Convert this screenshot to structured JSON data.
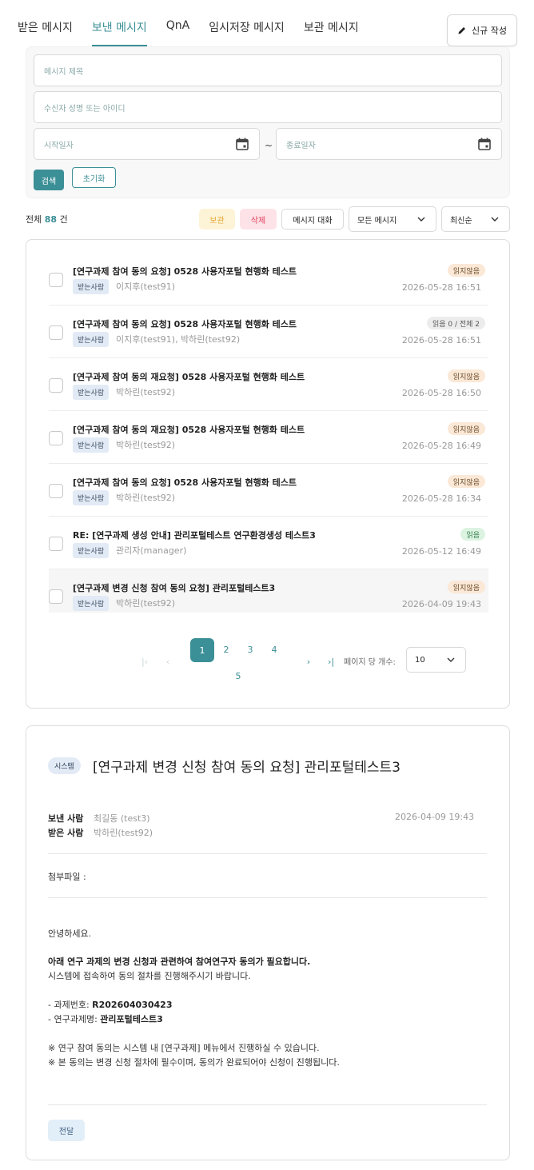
{
  "tabs": [
    {
      "label": "받은 메시지"
    },
    {
      "label": "보낸 메시지"
    },
    {
      "label": "QnA"
    },
    {
      "label": "임시저장 메시지"
    },
    {
      "label": "보관 메시지"
    }
  ],
  "active_tab": "보낸 메시지",
  "new_button": {
    "label": "신규 작성",
    "icon": "pencil-icon"
  },
  "search": {
    "title_placeholder": "메시지 제목",
    "recipient_placeholder": "수신자 성명 또는 아이디",
    "start_placeholder": "시작일자",
    "end_placeholder": "종료일자",
    "range_separator": "~",
    "search_label": "검색",
    "reset_label": "초기화"
  },
  "toolbar": {
    "total_prefix": "전체",
    "total_count": "88",
    "total_suffix": "건",
    "keep_label": "보관",
    "delete_label": "삭제",
    "conversation_label": "메시지 대화",
    "filter_value": "모든 메시지",
    "sort_value": "최신순"
  },
  "messages": [
    {
      "title": "[연구과제 참여 동의 요청] 0528 사용자포털 현행화 테스트",
      "recipient_tag": "받는사람",
      "recipients": "이지후(test91)",
      "status": "읽지않음",
      "status_type": "unread",
      "date": "2026-05-28 16:51"
    },
    {
      "title": "[연구과제 참여 동의 요청] 0528 사용자포털 현행화 테스트",
      "recipient_tag": "받는사람",
      "recipients": "이지후(test91), 박하린(test92)",
      "status": "읽음 0 / 전체 2",
      "status_type": "count",
      "date": "2026-05-28 16:51"
    },
    {
      "title": "[연구과제 참여 동의 재요청] 0528 사용자포털 현행화 테스트",
      "recipient_tag": "받는사람",
      "recipients": "박하린(test92)",
      "status": "읽지않음",
      "status_type": "unread",
      "date": "2026-05-28 16:50"
    },
    {
      "title": "[연구과제 참여 동의 재요청] 0528 사용자포털 현행화 테스트",
      "recipient_tag": "받는사람",
      "recipients": "박하린(test92)",
      "status": "읽지않음",
      "status_type": "unread",
      "date": "2026-05-28 16:49"
    },
    {
      "title": "[연구과제 참여 동의 요청] 0528 사용자포털 현행화 테스트",
      "recipient_tag": "받는사람",
      "recipients": "박하린(test92)",
      "status": "읽지않음",
      "status_type": "unread",
      "date": "2026-05-28 16:34"
    },
    {
      "title": "RE: [연구과제 생성 안내] 관리포털테스트 연구환경생성 테스트3",
      "recipient_tag": "받는사람",
      "recipients": "관리자(manager)",
      "status": "읽음",
      "status_type": "read",
      "date": "2026-05-12 16:49"
    },
    {
      "title": "[연구과제 변경 신청 참여 동의 요청] 관리포털테스트3",
      "recipient_tag": "받는사람",
      "recipients": "박하린(test92)",
      "status": "읽지않음",
      "status_type": "unread",
      "date": "2026-04-09 19:43"
    }
  ],
  "pagination": {
    "first": "|‹",
    "prev": "‹",
    "pages": [
      "1",
      "2",
      "3",
      "4",
      "5"
    ],
    "current": "1",
    "next": "›",
    "last": "›|",
    "per_page_label": "페이지 당 개수:",
    "per_page_value": "10"
  },
  "detail": {
    "badge": "시스템",
    "title": "[연구과제 변경 신청 참여 동의 요청] 관리포털테스트3",
    "sender_label": "보낸 사람",
    "sender": "최길동 (test3)",
    "receiver_label": "받은 사람",
    "receiver": "박하린(test92)",
    "date": "2026-04-09 19:43",
    "attachment_label": "첨부파일 :",
    "greeting": "안녕하세요.",
    "lead": "아래 연구 과제의 변경 신청과 관련하여 참여연구자 동의가 필요합니다.",
    "instruction": "시스템에 접속하여 동의 절차를 진행해주시기 바랍니다.",
    "project_no_label": "- 과제번호: ",
    "project_no": "R202604030423",
    "project_name_label": "- 연구과제명: ",
    "project_name": "관리포털테스트3",
    "note1": "※ 연구 참여 동의는 시스템 내 [연구과제] 메뉴에서 진행하실 수 있습니다.",
    "note2": "※ 본 동의는 변경 신청 절차에 필수이며, 동의가 완료되어야 신청이 진행됩니다.",
    "forward_label": "전달"
  },
  "colors": {
    "accent": "#3b8f96",
    "keep": "#e8a93a",
    "delete": "#e0405f"
  }
}
